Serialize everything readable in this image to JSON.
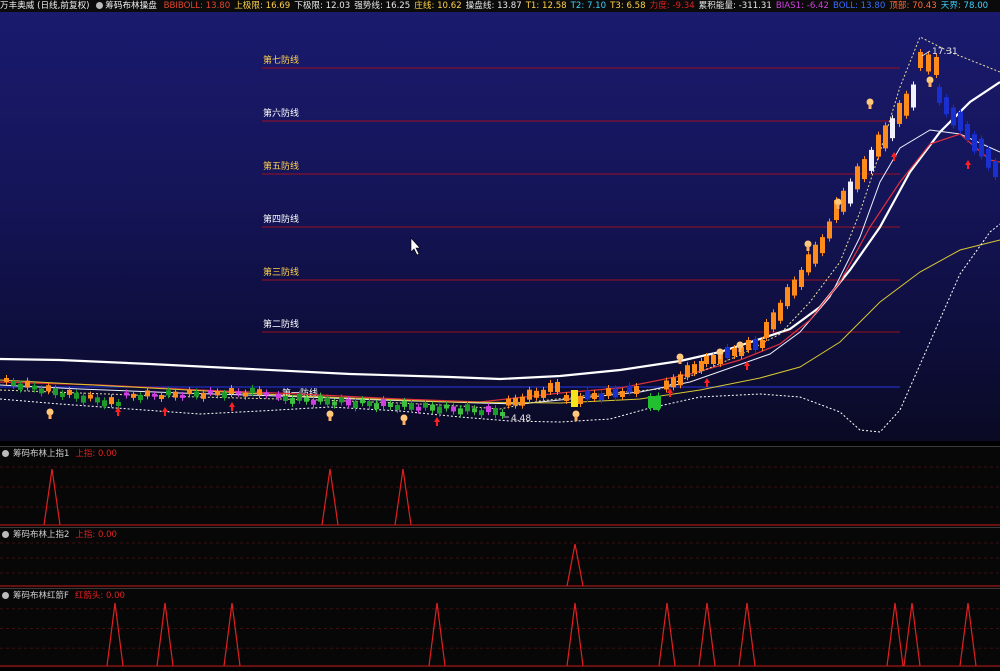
{
  "header": {
    "stock": "万丰奥威 (日线,前复权)",
    "indicator": "筹码布林操盘",
    "items": [
      {
        "label": "BBIBOLL: 13.80",
        "color": "#e0452d"
      },
      {
        "label": "上极限: 16.69",
        "color": "#ffd24a"
      },
      {
        "label": "下极限: 12.03",
        "color": "#e8e8e8"
      },
      {
        "label": "强势线: 16.25",
        "color": "#e8e8e8"
      },
      {
        "label": "庄线: 10.62",
        "color": "#ffd24a"
      },
      {
        "label": "操盘线: 13.87",
        "color": "#e8e8e8"
      },
      {
        "label": "T1: 12.58",
        "color": "#ffd24a"
      },
      {
        "label": "T2: 7.10",
        "color": "#3fd0ff"
      },
      {
        "label": "T3: 6.58",
        "color": "#ffd24a"
      },
      {
        "label": "力度: -9.34",
        "color": "#e02020"
      },
      {
        "label": "累积能量: -311.31",
        "color": "#e8e8e8"
      },
      {
        "label": "BIAS1: -6.42",
        "color": "#d040e0"
      },
      {
        "label": "BOLL: 13.80",
        "color": "#3a6cff"
      },
      {
        "label": "顶部: 70.43",
        "color": "#ff6a3a"
      },
      {
        "label": "天界: 78.00",
        "color": "#3fd0ff"
      }
    ]
  },
  "main": {
    "defense_lines": [
      {
        "label": "第七防线"
      },
      {
        "label": "第六防线"
      },
      {
        "label": "第五防线"
      },
      {
        "label": "第四防线"
      },
      {
        "label": "第三防线"
      },
      {
        "label": "第二防线"
      },
      {
        "label": "第一防线"
      }
    ],
    "high_label": "17.31",
    "low_label": "4.48",
    "colors": {
      "up": "#ff8c1a",
      "down": "#1c9a2a",
      "blue_bar": "#1a2fd0",
      "defense_red": "#9a1020",
      "defense_blue": "#2030c0",
      "text_gold": "#ffd24a"
    }
  },
  "subcharts": [
    {
      "label": "筹码布林上指1",
      "value": "上指: 0.00"
    },
    {
      "label": "筹码布林上指2",
      "value": "上指: 0.00"
    },
    {
      "label": "筹码布林红箭F",
      "value": "红箭头: 0.00"
    }
  ]
}
